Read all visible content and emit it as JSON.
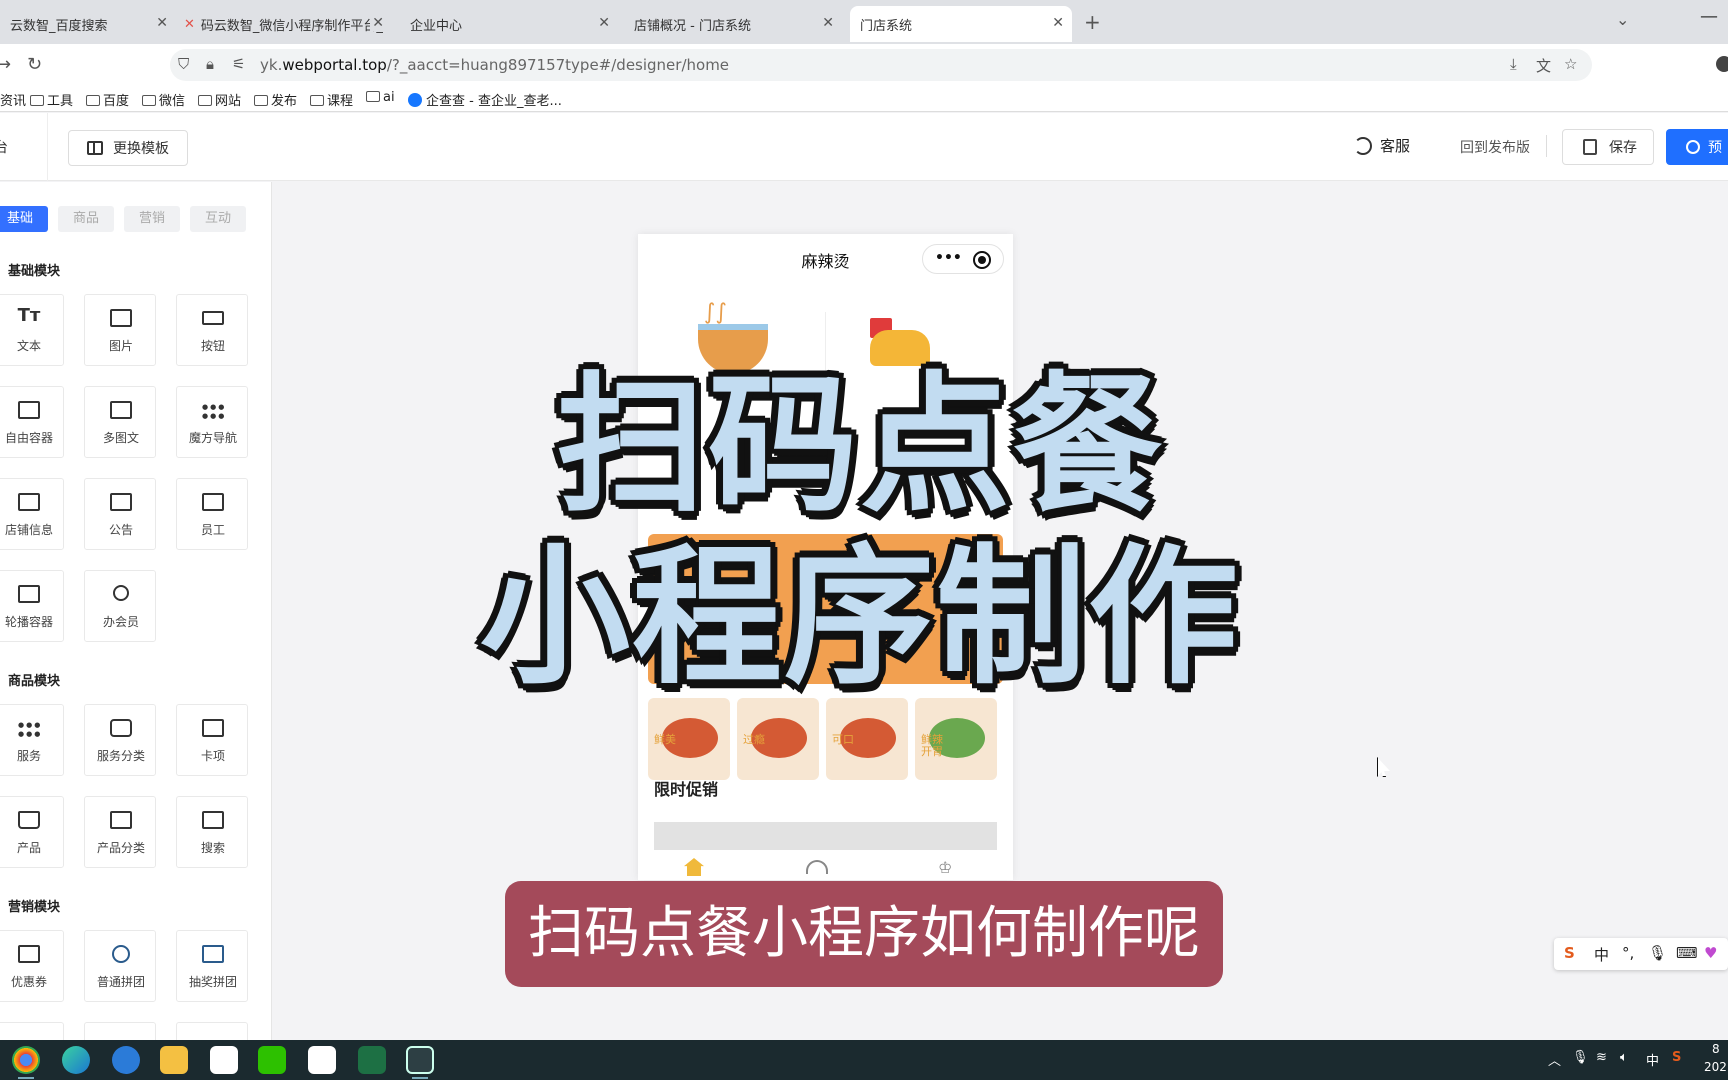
{
  "browser": {
    "tabs": [
      {
        "title": "云数智_百度搜索",
        "active": false
      },
      {
        "title": "码云数智_微信小程序制作平台_",
        "active": false
      },
      {
        "title": "企业中心",
        "active": false
      },
      {
        "title": "店铺概况 - 门店系统",
        "active": false
      },
      {
        "title": "门店系统",
        "active": true
      }
    ],
    "url_prefix": "yk.",
    "url_domain": "webportal.top",
    "url_rest": "/?_aacct=huang897157type#/designer/home",
    "bookmarks": [
      "资讯",
      "工具",
      "百度",
      "微信",
      "网站",
      "发布",
      "课程",
      "ai",
      "企查查 - 查企业_查老..."
    ]
  },
  "header": {
    "left_glyph": "台",
    "change_template": "更换模板",
    "customer_service": "客服",
    "revert": "回到发布版",
    "save": "保存",
    "preview": "预"
  },
  "sidebar": {
    "tabs": [
      "基础",
      "商品",
      "营销",
      "互动"
    ],
    "sections": [
      {
        "title": "基础模块",
        "items": [
          "文本",
          "图片",
          "按钮",
          "自由容器",
          "多图文",
          "魔方导航",
          "店铺信息",
          "公告",
          "员工",
          "轮播容器",
          "办会员"
        ]
      },
      {
        "title": "商品模块",
        "items": [
          "服务",
          "服务分类",
          "卡项",
          "产品",
          "产品分类",
          "搜索"
        ]
      },
      {
        "title": "营销模块",
        "items": [
          "优惠券",
          "普通拼团",
          "抽奖拼团"
        ]
      }
    ]
  },
  "phone": {
    "title": "麻辣烫",
    "capsule_more": "•••",
    "food_labels": [
      "鲜美",
      "过瘾",
      "可口",
      "鲜辣开胃"
    ],
    "promo_title": "限时促销"
  },
  "overlay": {
    "line1": "扫码点餐",
    "line2": "小程序制作",
    "caption": "扫码点餐小程序如何制作呢"
  },
  "ime": {
    "lang": "中"
  },
  "taskbar": {
    "tray_lang": "中",
    "clock_top": "8",
    "clock_bottom": "202"
  }
}
